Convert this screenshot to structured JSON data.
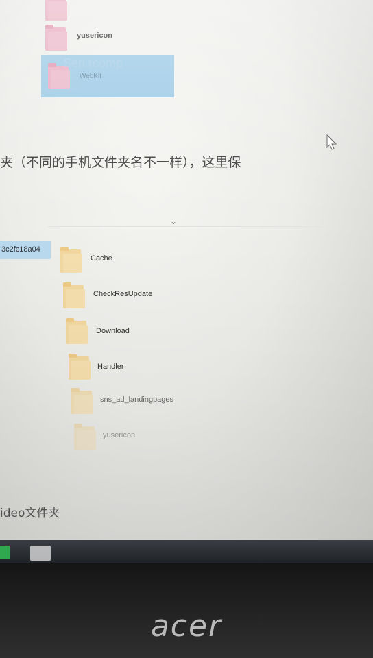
{
  "top_items": [
    {
      "name": "yusericon"
    },
    {
      "name": "Sen.rcomp",
      "sub": "WebKit"
    }
  ],
  "instruction_text": "夹（不同的手机文件夹名不一样），这里保",
  "selected_folder_fragment": "3c2fc18a04",
  "folders": [
    {
      "name": "Cache"
    },
    {
      "name": "CheckResUpdate"
    },
    {
      "name": "Download"
    },
    {
      "name": "Handler"
    },
    {
      "name": "sns_ad_landingpages"
    },
    {
      "name": "yusericon"
    }
  ],
  "bottom_text": "ideo文件夹",
  "brand": "acer",
  "icons": [
    "folder-icon",
    "mouse-pointer-icon",
    "windows-start-icon",
    "explorer-taskbar-icon",
    "chevron-down-icon"
  ]
}
